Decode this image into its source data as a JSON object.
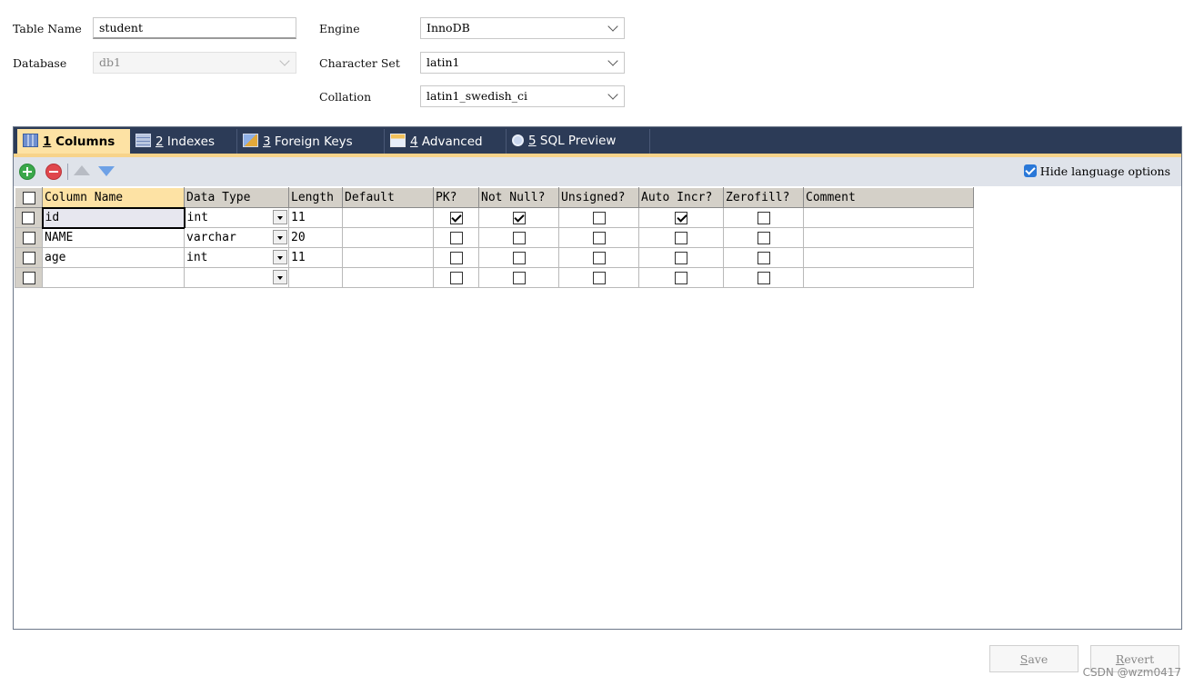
{
  "form": {
    "table_name_label": "Table Name",
    "table_name_value": "student",
    "database_label": "Database",
    "database_value": "db1",
    "engine_label": "Engine",
    "engine_value": "InnoDB",
    "charset_label": "Character Set",
    "charset_value": "latin1",
    "collation_label": "Collation",
    "collation_value": "latin1_swedish_ci"
  },
  "tabs": [
    {
      "num": "1",
      "label": " Columns",
      "icon": "table-columns-icon"
    },
    {
      "num": "2",
      "label": " Indexes",
      "icon": "index-icon"
    },
    {
      "num": "3",
      "label": " Foreign Keys",
      "icon": "foreign-key-icon"
    },
    {
      "num": "4",
      "label": " Advanced",
      "icon": "advanced-icon"
    },
    {
      "num": "5",
      "label": " SQL Preview",
      "icon": "sql-preview-icon"
    }
  ],
  "toolbar": {
    "hide_language_label": "Hide language options",
    "hide_language_checked": true
  },
  "grid": {
    "headers": [
      "Column Name",
      "Data Type",
      "Length",
      "Default",
      "PK?",
      "Not Null?",
      "Unsigned?",
      "Auto Incr?",
      "Zerofill?",
      "Comment"
    ],
    "rows": [
      {
        "name": "id",
        "type": "int",
        "length": "11",
        "default": "",
        "pk": true,
        "not_null": true,
        "unsigned": false,
        "auto_incr": true,
        "zerofill": false,
        "comment": ""
      },
      {
        "name": "NAME",
        "type": "varchar",
        "length": "20",
        "default": "",
        "pk": false,
        "not_null": false,
        "unsigned": false,
        "auto_incr": false,
        "zerofill": false,
        "comment": ""
      },
      {
        "name": "age",
        "type": "int",
        "length": "11",
        "default": "",
        "pk": false,
        "not_null": false,
        "unsigned": false,
        "auto_incr": false,
        "zerofill": false,
        "comment": ""
      },
      {
        "name": "",
        "type": "",
        "length": "",
        "default": "",
        "pk": false,
        "not_null": false,
        "unsigned": false,
        "auto_incr": false,
        "zerofill": false,
        "comment": ""
      }
    ]
  },
  "buttons": {
    "save_hotkey": "S",
    "save_rest": "ave",
    "revert_hotkey": "R",
    "revert_rest": "evert"
  },
  "watermark": "CSDN @wzm0417",
  "colors": {
    "tabbar": "#2c3b57",
    "active_tab": "#fde2a4",
    "accent_line": "#f7d38a",
    "toolbar": "#dfe3ea",
    "checkbox_blue": "#2a78d8"
  }
}
